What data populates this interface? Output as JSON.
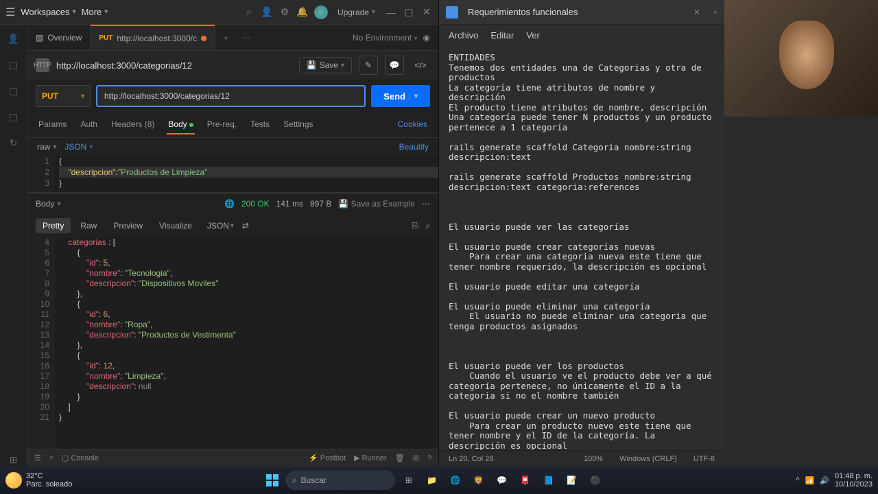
{
  "postman": {
    "header": {
      "workspaces": "Workspaces",
      "more": "More",
      "upgrade": "Upgrade"
    },
    "tabs": {
      "overview": "Overview",
      "active_method": "PUT",
      "active_title": "http://localhost:3000/c",
      "no_env": "No Environment"
    },
    "request": {
      "title": "http://localhost:3000/categorias/12",
      "save": "Save",
      "method": "PUT",
      "url": "http://localhost:3000/categorias/12",
      "send": "Send"
    },
    "subtabs": {
      "params": "Params",
      "auth": "Auth",
      "headers": "Headers",
      "headers_count": "(8)",
      "body": "Body",
      "prereq": "Pre-req.",
      "tests": "Tests",
      "settings": "Settings",
      "cookies": "Cookies"
    },
    "bodyOpts": {
      "raw": "raw",
      "json": "JSON",
      "beautify": "Beautify"
    },
    "reqBody": {
      "line1_key": "\"descripcion\"",
      "line1_val": "\"Productos de Limpieza\""
    },
    "response": {
      "body": "Body",
      "status": "200 OK",
      "time": "141 ms",
      "size": "897 B",
      "saveExample": "Save as Example",
      "pretty": "Pretty",
      "raw": "Raw",
      "preview": "Preview",
      "visualize": "Visualize",
      "json": "JSON"
    },
    "respBody": {
      "l4": "categorias",
      "id5": "5",
      "nombre5": "\"Tecnologia\"",
      "desc5": "\"Dispositivos Moviles\"",
      "id6": "6",
      "nombre6": "\"Ropa\"",
      "desc6": "\"Productos de Vestimenta\"",
      "id12": "12",
      "nombre12": "\"Limpieza\"",
      "desc12": "null",
      "key_id": "\"id\"",
      "key_nombre": "\"nombre\"",
      "key_desc": "\"descripcion\""
    },
    "footer": {
      "console": "Console",
      "postbot": "Postbot",
      "runner": "Runner"
    }
  },
  "notepad": {
    "title": "Requerimientos funcionales",
    "menu": {
      "file": "Archivo",
      "edit": "Editar",
      "view": "Ver"
    },
    "content": "ENTIDADES\nTenemos dos entidades una de Categorias y otra de productos\nLa categoría tiene atributos de nombre y descripción\nEl producto tiene atributos de nombre, descripción\nUna categoría puede tener N productos y un producto pertenece a 1 categoría\n\nrails generate scaffold Categoria nombre:string descripcion:text\n\nrails generate scaffold Productos nombre:string descripcion:text categoria:references\n\n\n\nEl usuario puede ver las categorías\n\nEl usuario puede crear categorías nuevas\n    Para crear una categoria nueva este tiene que tener nombre requerido, la descripción es opcional\n\nEl usuario puede editar una categoría\n\nEl usuario puede eliminar una categoría\n    El usuario no puede eliminar una categoria que tenga productos asignados\n\n\n\nEl usuario puede ver los productos\n    Cuando el usuario ve el producto debe ver a qué categoría pertenece, no únicamente el ID a la categoria si no el nombre también\n\nEl usuario puede crear un nuevo producto\n    Para crear un producto nuevo este tiene que tener nombre y el ID de la categoría. La descripción es opcional\n\nEl usuario puede editar un producto\n\nEl usuario puede eliminar un producto\n    Si el usuario elimina todos los productos de una categoría, ya debería de poder eliminar la categoría a la que pertenecían los productos",
    "status": {
      "pos": "Ln 20, Col 28",
      "zoom": "100%",
      "eol": "Windows (CRLF)",
      "enc": "UTF-8"
    }
  },
  "taskbar": {
    "temp": "32°C",
    "weather": "Parc. soleado",
    "search_placeholder": "Buscar",
    "time": "01:48 p. m.",
    "date": "10/10/2023"
  }
}
